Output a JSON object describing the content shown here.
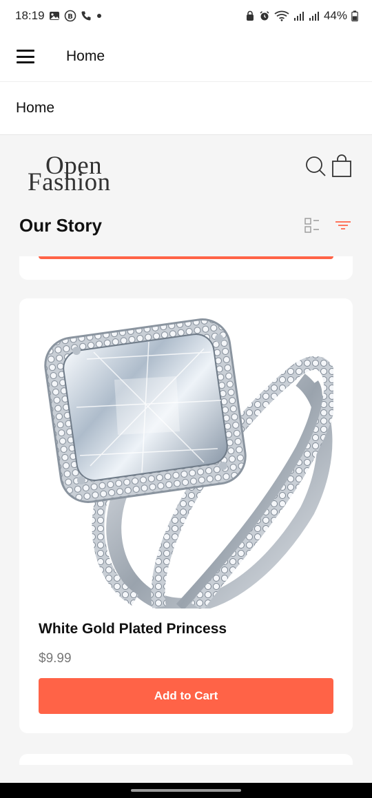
{
  "status_bar": {
    "time": "18:19",
    "battery": "44%",
    "left_icons": [
      "gallery-icon",
      "b-badge-icon",
      "phone-icon",
      "dot-icon"
    ],
    "right_icons": [
      "lock-icon",
      "alarm-icon",
      "wifi-icon",
      "signal-icon",
      "signal-icon",
      "battery-icon"
    ]
  },
  "app_bar": {
    "title": "Home",
    "menu_icon": "hamburger-menu-icon"
  },
  "page_header": {
    "title": "Home"
  },
  "brand": {
    "logo_line1": "Open",
    "logo_line2": "Fashion",
    "search_icon": "search-icon",
    "cart_icon": "shopping-bag-icon"
  },
  "section": {
    "title": "Our Story",
    "view_icon": "list-view-icon",
    "filter_icon": "filter-icon",
    "accent_color": "#ff6347"
  },
  "products": [
    {
      "name": "White Gold Plated Princess",
      "price": "$9.99",
      "button_label": "Add to Cart",
      "image": "diamond-ring-image"
    }
  ],
  "colors": {
    "accent": "#ff6347",
    "background": "#f5f5f5",
    "card": "#ffffff",
    "price_text": "#777777"
  }
}
